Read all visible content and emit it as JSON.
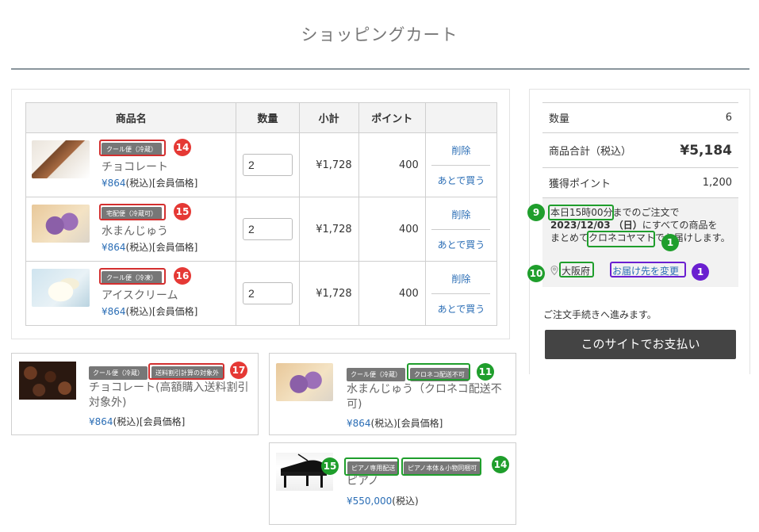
{
  "page": {
    "title": "ショッピングカート"
  },
  "cart": {
    "headers": {
      "product": "商品名",
      "qty": "数量",
      "subtotal": "小計",
      "points": "ポイント"
    },
    "items": [
      {
        "badge": "クール便（冷蔵）",
        "name": "チョコレート",
        "price_yen": "¥864",
        "price_note": "(税込)[会員価格]",
        "qty": "2",
        "subtotal": "¥1,728",
        "points": "400",
        "delete": "削除",
        "later": "あとで買う",
        "marker": "14"
      },
      {
        "badge": "宅配便（冷蔵可）",
        "name": "水まんじゅう",
        "price_yen": "¥864",
        "price_note": "(税込)[会員価格]",
        "qty": "2",
        "subtotal": "¥1,728",
        "points": "400",
        "delete": "削除",
        "later": "あとで買う",
        "marker": "15"
      },
      {
        "badge": "クール便（冷凍）",
        "name": "アイスクリーム",
        "price_yen": "¥864",
        "price_note": "(税込)[会員価格]",
        "qty": "2",
        "subtotal": "¥1,728",
        "points": "400",
        "delete": "削除",
        "later": "あとで買う",
        "marker": "16"
      }
    ]
  },
  "summary": {
    "qty_label": "数量",
    "qty_value": "6",
    "total_label": "商品合計（税込）",
    "total_value": "¥5,184",
    "points_label": "獲得ポイント",
    "points_value": "1,200",
    "delivery": {
      "deadline": "本日15時00分",
      "text1": "までのご注文で",
      "date": "2023/12/03 （日）",
      "text2": "にすべての商品を",
      "text3": "まとめて",
      "carrier": "クロネコヤマト",
      "text4": "でお届けします。",
      "prefecture": "大阪府",
      "change_link": "お届け先を変更"
    },
    "proceed_text": "ご注文手続きへ進みます。",
    "pay_button": "このサイトでお支払い",
    "markers": {
      "deadline": "9",
      "carrier": "1",
      "prefecture": "10",
      "change": "1"
    }
  },
  "recommendations": [
    {
      "badges": [
        "クール便（冷蔵）",
        "送料割引計算の対象外"
      ],
      "name": "チョコレート(高額購入送料割引対象外)",
      "price_yen": "¥864",
      "price_note": "(税込)[会員価格]",
      "marker": "17"
    },
    {
      "badges": [
        "クール便（冷蔵）",
        "クロネコ配送不可"
      ],
      "name": "水まんじゅう（クロネコ配送不可)",
      "price_yen": "¥864",
      "price_note": "(税込)[会員価格]",
      "marker": "11"
    },
    {
      "badges": [
        "ピアノ専用配送",
        "ピアノ本体＆小物同梱可"
      ],
      "name": "ピアノ",
      "price_yen": "¥550,000",
      "price_note": "(税込)",
      "markers": [
        "15",
        "14"
      ]
    }
  ],
  "colors": {
    "accent_link": "#2a6db5",
    "pay_button_bg": "#444444",
    "marker_red": "#e53935",
    "marker_green": "#1f9e2c",
    "marker_purple": "#6a1fd0"
  }
}
